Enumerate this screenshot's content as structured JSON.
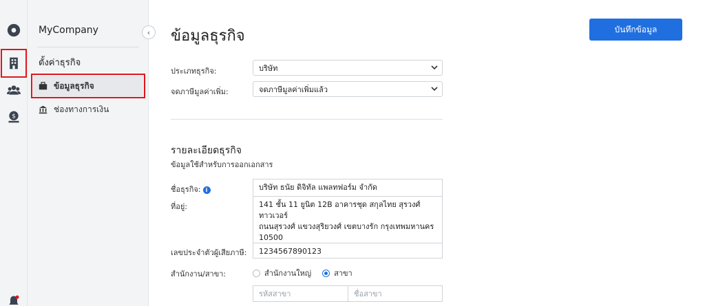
{
  "sidebar": {
    "company": "MyCompany",
    "section_title": "ตั้งค่าธุรกิจ",
    "items": [
      {
        "label": "ข้อมูลธุรกิจ",
        "icon": "briefcase-icon",
        "active": true
      },
      {
        "label": "ช่องทางการเงิน",
        "icon": "bank-icon",
        "active": false
      }
    ]
  },
  "rail": {
    "icons": [
      "gear-icon",
      "building-icon",
      "users-icon",
      "money-icon",
      "bell-icon"
    ]
  },
  "header": {
    "title": "ข้อมูลธุรกิจ",
    "save_label": "บันทึกข้อมูล"
  },
  "form": {
    "business_type_label": "ประเภทธุรกิจ:",
    "business_type_value": "บริษัท",
    "vat_label": "จดภาษีมูลค่าเพิ่ม:",
    "vat_value": "จดภาษีมูลค่าเพิ่มแล้ว",
    "details_title": "รายละเอียดธุรกิจ",
    "details_subtitle": "ข้อมูลใช้สำหรับการออกเอกสาร",
    "name_label": "ชื่อธุรกิจ:",
    "name_value": "บริษัท ธนัย ดิจิทัล แพลทฟอร์ม จำกัด",
    "address_label": "ที่อยู่:",
    "address_line1": "141 ชั้น 11 ยูนิต 12B อาคารชุด สกุลไทย สุรวงศ์",
    "address_line2": "ทาวเวอร์",
    "address_line3": "ถนนสุรวงศ์ แขวงสุริยวงศ์ เขตบางรัก กรุงเทพมหานคร",
    "address_line4": "10500",
    "tax_id_label": "เลขประจำตัวผู้เสียภาษี:",
    "tax_id_value": "1234567890123",
    "branch_label": "สำนักงาน/สาขา:",
    "branch_options": [
      "สำนักงานใหญ่",
      "สาขา"
    ],
    "branch_selected": "สาขา",
    "branch_code_placeholder": "รหัสสาขา",
    "branch_name_placeholder": "ชื่อสาขา"
  },
  "colors": {
    "accent": "#1f6fe0",
    "highlight": "#e0161b"
  }
}
